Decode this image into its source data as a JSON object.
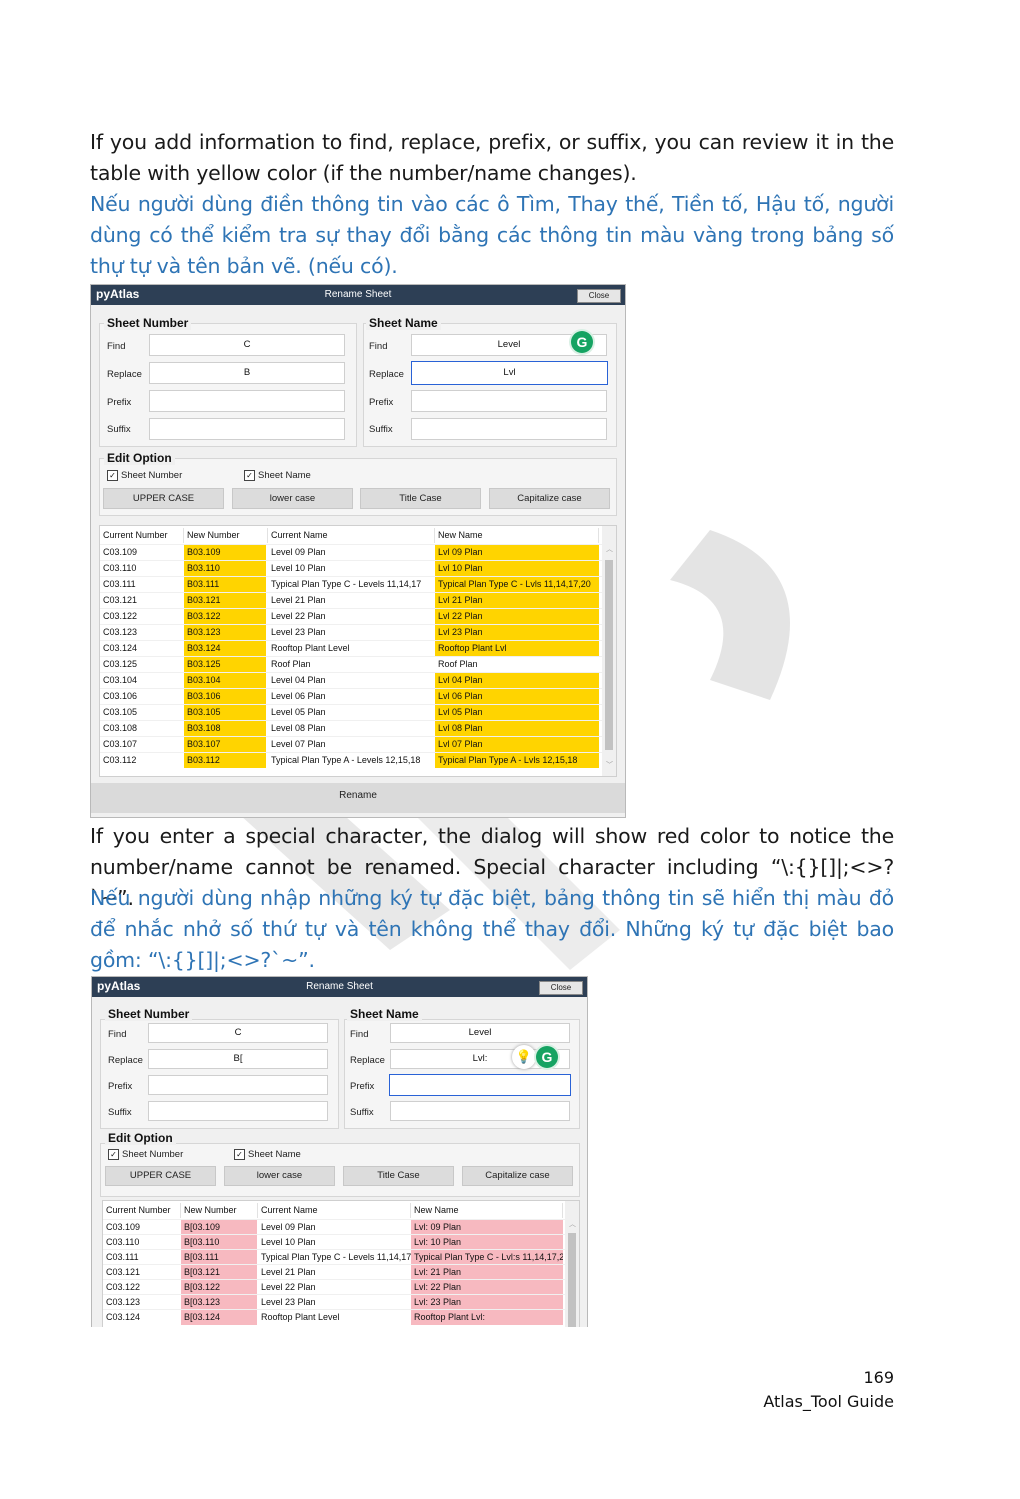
{
  "paragraphs": {
    "p1_en": "If you add information to find, replace, prefix, or suffix, you can review it in the table with yellow color (if the number/name changes).",
    "p1_vi": "Nếu người dùng điền thông tin vào các ô Tìm, Thay thế, Tiền tố, Hậu tố, người dùng có thể kiểm tra sự thay đổi bằng các thông tin màu vàng trong bảng số thự tự và tên bản vẽ. (nếu có).",
    "p2_en": "If you enter a special character, the dialog will show red color to notice the number/name cannot be renamed. Special character including “\\:{}[]|;<>?`~”.",
    "p2_vi": "Nếu người dùng nhập những ký tự đặc biệt, bảng thông tin sẽ hiển thị màu đỏ để nhắc nhở số thứ tự và tên không thể thay đổi. Những ký tự đặc biệt bao gồm: “\\:{}[]|;<>?`~”."
  },
  "dialog": {
    "app_name": "pyAtlas",
    "title": "Rename Sheet",
    "close_label": "Close",
    "sheet_number_title": "Sheet Number",
    "sheet_name_title": "Sheet Name",
    "field_labels": {
      "find": "Find",
      "replace": "Replace",
      "prefix": "Prefix",
      "suffix": "Suffix"
    },
    "edit_option_title": "Edit Option",
    "check_sheet_number": "Sheet Number",
    "check_sheet_name": "Sheet Name",
    "check_mark": "✓",
    "case_buttons": {
      "upper": "UPPER CASE",
      "lower": "lower case",
      "title": "Title Case",
      "capitalize": "Capitalize case"
    },
    "columns": {
      "current_number": "Current Number",
      "new_number": "New Number",
      "current_name": "Current Name",
      "new_name": "New Name"
    },
    "rename_label": "Rename",
    "grammarly_glyph": "G",
    "bulb_glyph": "💡",
    "scroll_up": "︿",
    "scroll_down": "﹀"
  },
  "dialog1": {
    "sn_find": "C",
    "sn_replace": "B",
    "sn_prefix": "",
    "sn_suffix": "",
    "nm_find": "Level",
    "nm_replace": "Lvl",
    "nm_prefix": "",
    "nm_suffix": "",
    "rows": [
      {
        "cn": "C03.109",
        "nn": "B03.109",
        "cname": "Level 09 Plan",
        "nname": "Lvl 09 Plan",
        "changed": true
      },
      {
        "cn": "C03.110",
        "nn": "B03.110",
        "cname": "Level 10 Plan",
        "nname": "Lvl 10 Plan",
        "changed": true
      },
      {
        "cn": "C03.111",
        "nn": "B03.111",
        "cname": "Typical Plan Type C - Levels 11,14,17",
        "nname": "Typical Plan Type C - Lvls 11,14,17,20",
        "changed": true
      },
      {
        "cn": "C03.121",
        "nn": "B03.121",
        "cname": "Level 21 Plan",
        "nname": "Lvl 21 Plan",
        "changed": true
      },
      {
        "cn": "C03.122",
        "nn": "B03.122",
        "cname": "Level 22 Plan",
        "nname": "Lvl 22 Plan",
        "changed": true
      },
      {
        "cn": "C03.123",
        "nn": "B03.123",
        "cname": "Level 23 Plan",
        "nname": "Lvl 23 Plan",
        "changed": true
      },
      {
        "cn": "C03.124",
        "nn": "B03.124",
        "cname": "Rooftop Plant Level",
        "nname": "Rooftop Plant Lvl",
        "changed": true
      },
      {
        "cn": "C03.125",
        "nn": "B03.125",
        "cname": "Roof Plan",
        "nname": "Roof Plan",
        "changed": false
      },
      {
        "cn": "C03.104",
        "nn": "B03.104",
        "cname": "Level 04 Plan",
        "nname": "Lvl 04 Plan",
        "changed": true
      },
      {
        "cn": "C03.106",
        "nn": "B03.106",
        "cname": "Level 06 Plan",
        "nname": "Lvl 06 Plan",
        "changed": true
      },
      {
        "cn": "C03.105",
        "nn": "B03.105",
        "cname": "Level 05 Plan",
        "nname": "Lvl 05 Plan",
        "changed": true
      },
      {
        "cn": "C03.108",
        "nn": "B03.108",
        "cname": "Level 08 Plan",
        "nname": "Lvl 08 Plan",
        "changed": true
      },
      {
        "cn": "C03.107",
        "nn": "B03.107",
        "cname": "Level 07 Plan",
        "nname": "Lvl 07 Plan",
        "changed": true
      },
      {
        "cn": "C03.112",
        "nn": "B03.112",
        "cname": "Typical Plan Type A - Levels 12,15,18",
        "nname": "Typical Plan Type A - Lvls 12,15,18",
        "changed": true
      }
    ]
  },
  "dialog2": {
    "sn_find": "C",
    "sn_replace": "B[",
    "sn_prefix": "",
    "sn_suffix": "",
    "nm_find": "Level",
    "nm_replace": "Lvl:",
    "nm_prefix": "",
    "nm_suffix": "",
    "rows": [
      {
        "cn": "C03.109",
        "nn": "B[03.109",
        "cname": "Level 09 Plan",
        "nname": "Lvl: 09 Plan"
      },
      {
        "cn": "C03.110",
        "nn": "B[03.110",
        "cname": "Level 10 Plan",
        "nname": "Lvl: 10 Plan"
      },
      {
        "cn": "C03.111",
        "nn": "B[03.111",
        "cname": "Typical Plan Type C - Levels 11,14,17",
        "nname": "Typical Plan Type C - Lvl:s 11,14,17,2"
      },
      {
        "cn": "C03.121",
        "nn": "B[03.121",
        "cname": "Level 21 Plan",
        "nname": "Lvl: 21 Plan"
      },
      {
        "cn": "C03.122",
        "nn": "B[03.122",
        "cname": "Level 22 Plan",
        "nname": "Lvl: 22 Plan"
      },
      {
        "cn": "C03.123",
        "nn": "B[03.123",
        "cname": "Level 23 Plan",
        "nname": "Lvl: 23 Plan"
      },
      {
        "cn": "C03.124",
        "nn": "B[03.124",
        "cname": "Rooftop Plant Level",
        "nname": "Rooftop Plant Lvl:"
      }
    ]
  },
  "footer": {
    "page_number": "169",
    "guide_name": "Atlas_Tool Guide"
  },
  "colors": {
    "title_bar": "#2d3f55",
    "vietnamese_text": "#2e74b5",
    "changed_highlight": "#ffd400",
    "error_highlight": "#f7b9c0",
    "grammarly": "#15a362"
  }
}
